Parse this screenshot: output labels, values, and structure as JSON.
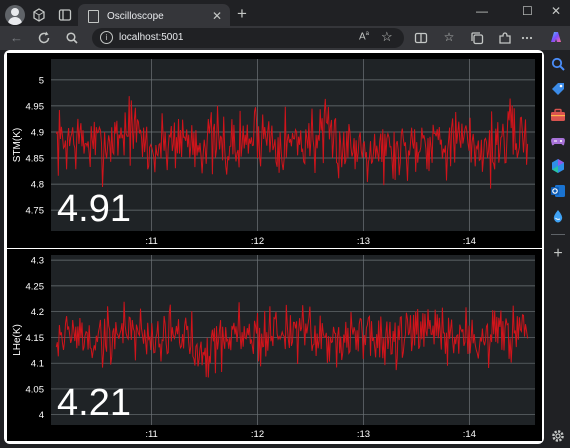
{
  "tab": {
    "title": "Oscilloscope"
  },
  "address": {
    "url": "localhost:5001"
  },
  "colors": {
    "trace": "#d1141b",
    "plot_bg": "#1f2326",
    "grid": "#6e7478",
    "text": "#ffffff"
  },
  "icons": {
    "profile": "avatar-icon",
    "workspaces": "workspaces-icon",
    "tab_actions": "tab-actions-icon",
    "back": "back-icon",
    "refresh": "refresh-icon",
    "search": "search-icon",
    "read_aloud": "read-aloud-icon",
    "favorite": "star-icon",
    "split_screen": "split-screen-icon",
    "favorites": "favorites-icon",
    "collections": "collections-icon",
    "extensions": "extensions-icon",
    "copilot": "copilot-icon",
    "settings": "gear-icon"
  },
  "chart_data": [
    {
      "type": "line",
      "ylabel": "STM(K)",
      "ylim": [
        4.71,
        5.04
      ],
      "yticks": [
        4.75,
        4.8,
        4.85,
        4.9,
        4.95,
        5
      ],
      "ytick_labels": [
        "4.75",
        "4.8",
        "4.85",
        "4.9",
        "4.95",
        "5"
      ],
      "xlim": [
        10.05,
        14.62
      ],
      "xticks": [
        11,
        12,
        13,
        14
      ],
      "xtick_labels": [
        ":11",
        ":12",
        ":13",
        ":14"
      ],
      "current_value": "4.91",
      "grid": true,
      "series": [
        {
          "mean": 4.88,
          "spread": 0.045,
          "samples": 460,
          "seed": 7,
          "x": [
            10.2,
            10.5,
            10.8,
            11.0,
            11.2,
            11.5,
            11.8,
            12.0,
            12.3,
            12.6,
            12.9,
            13.0,
            13.3,
            13.6,
            13.9,
            14.2,
            14.5
          ],
          "values": [
            4.89,
            4.87,
            4.91,
            4.86,
            4.89,
            4.88,
            4.87,
            4.9,
            4.88,
            4.89,
            4.87,
            4.88,
            4.86,
            4.89,
            4.88,
            4.87,
            4.9
          ]
        }
      ]
    },
    {
      "type": "line",
      "ylabel": "LHe(K)",
      "ylim": [
        3.98,
        4.31
      ],
      "yticks": [
        4,
        4.05,
        4.1,
        4.15,
        4.2,
        4.25,
        4.3
      ],
      "ytick_labels": [
        "4",
        "4.05",
        "4.1",
        "4.15",
        "4.2",
        "4.25",
        "4.3"
      ],
      "xlim": [
        10.05,
        14.62
      ],
      "xticks": [
        11,
        12,
        13,
        14
      ],
      "xtick_labels": [
        ":11",
        ":12",
        ":13",
        ":14"
      ],
      "current_value": "4.21",
      "grid": true,
      "series": [
        {
          "mean": 4.155,
          "spread": 0.04,
          "samples": 460,
          "seed": 19,
          "x": [
            10.2,
            10.5,
            10.8,
            11.0,
            11.2,
            11.5,
            11.8,
            12.0,
            12.3,
            12.6,
            12.9,
            13.0,
            13.3,
            13.6,
            13.9,
            14.2,
            14.5
          ],
          "values": [
            4.16,
            4.14,
            4.17,
            4.15,
            4.16,
            4.13,
            4.16,
            4.15,
            4.17,
            4.14,
            4.16,
            4.15,
            4.14,
            4.16,
            4.15,
            4.15,
            4.16
          ]
        }
      ]
    }
  ]
}
